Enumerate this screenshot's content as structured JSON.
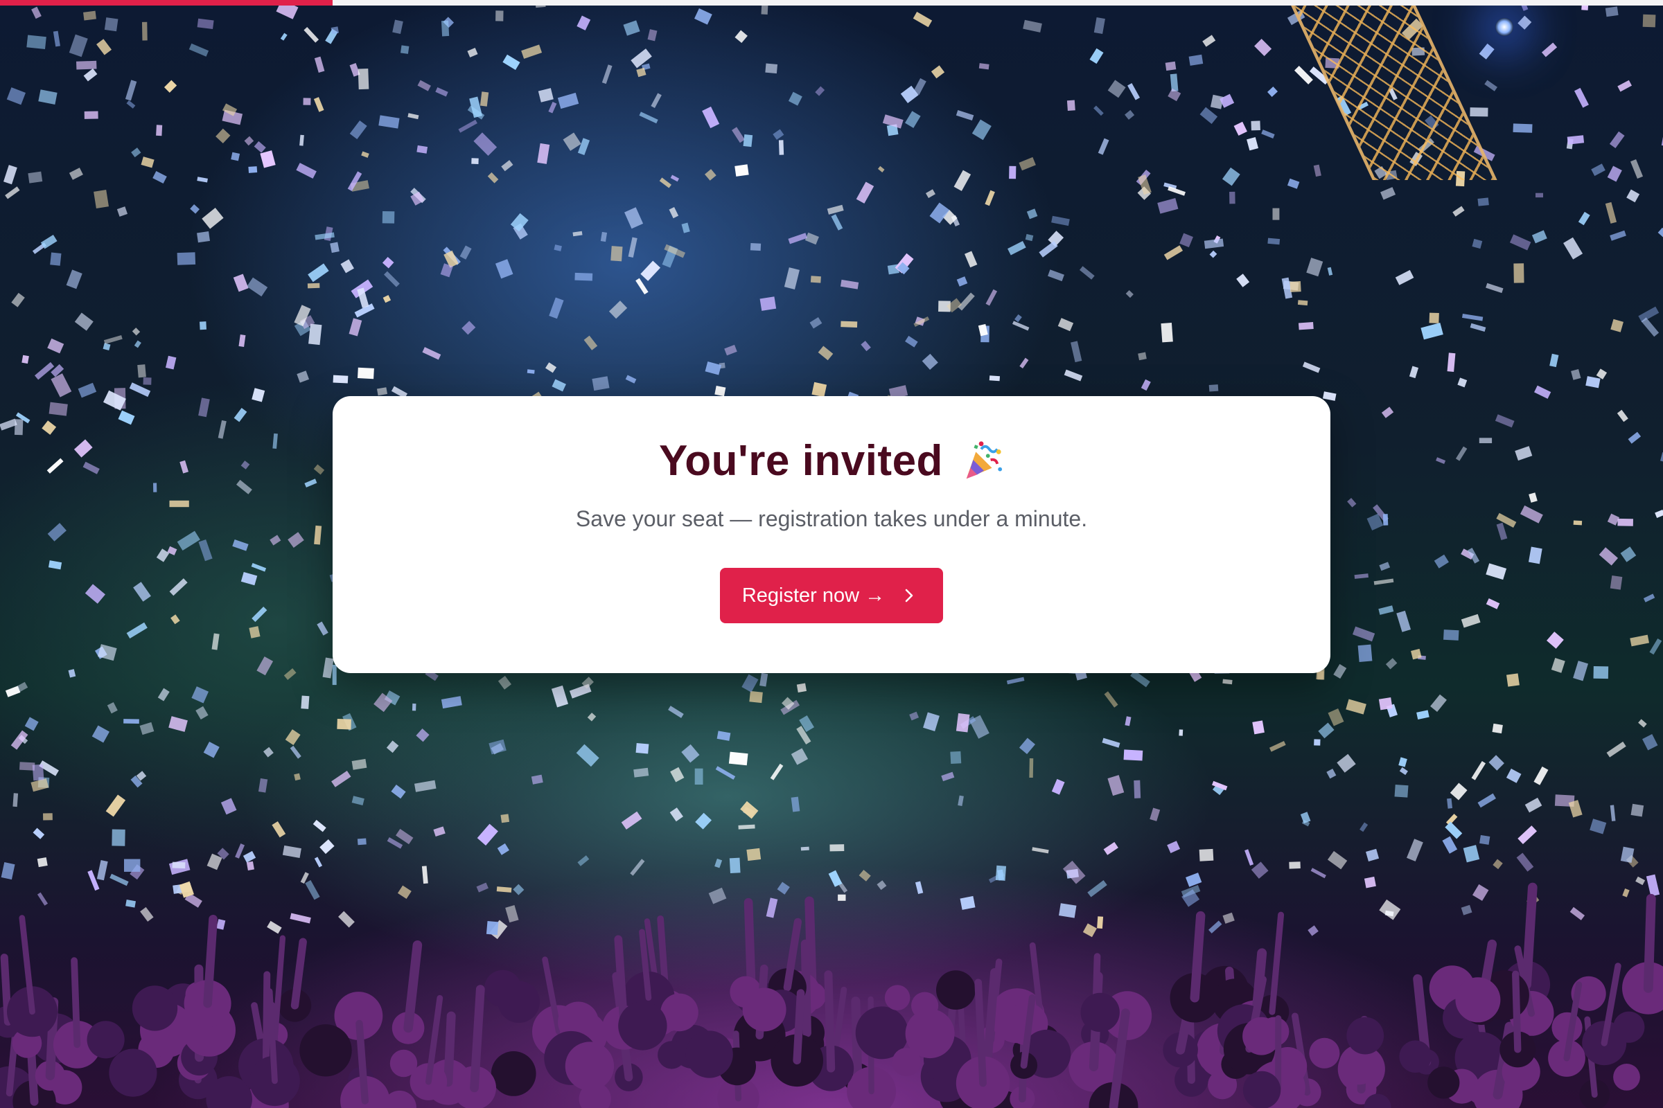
{
  "progress": {
    "value": 0.2
  },
  "invite": {
    "title": "You're invited",
    "title_icon": "party-popper-icon",
    "subtitle": "Save your seat — registration takes under a minute.",
    "cta_label": "Register now →",
    "cta_icon": "chevron-right-icon"
  },
  "colors": {
    "accent": "#e0214a",
    "title": "#4a0a1f",
    "subtitle": "#5b5e66",
    "card": "#ffffff"
  },
  "background": {
    "image": "concert-confetti-photo"
  }
}
